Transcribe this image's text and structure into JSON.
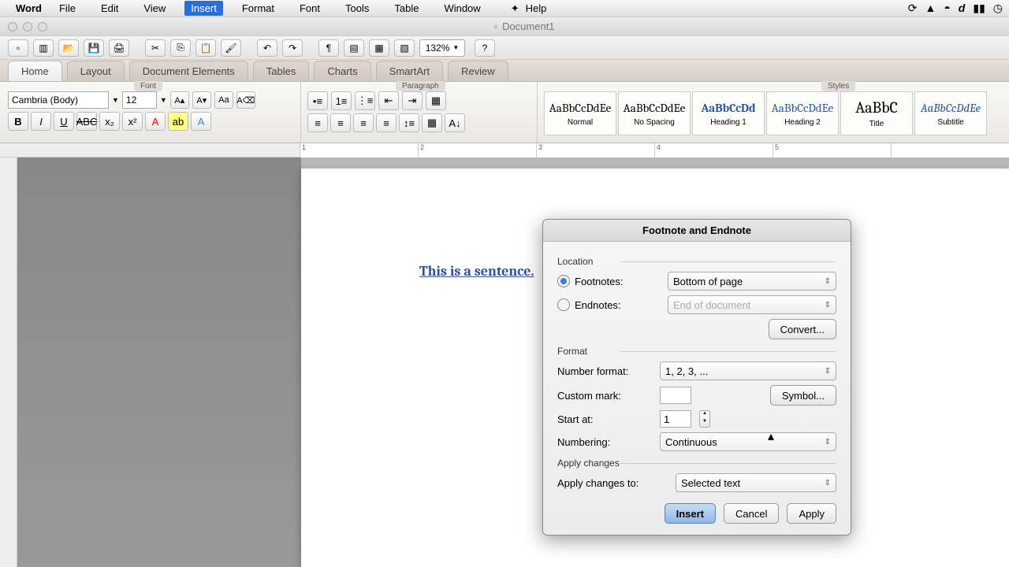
{
  "menubar": {
    "app": "Word",
    "items": [
      "File",
      "Edit",
      "View",
      "Insert",
      "Format",
      "Font",
      "Tools",
      "Table",
      "Window"
    ],
    "help": "Help",
    "active_index": 3
  },
  "titlebar": {
    "doc_name": "Document1"
  },
  "toolbar": {
    "zoom": "132%"
  },
  "ribbon": {
    "tabs": [
      "Home",
      "Layout",
      "Document Elements",
      "Tables",
      "Charts",
      "SmartArt",
      "Review"
    ],
    "active_tab": 0,
    "groups": {
      "font": "Font",
      "paragraph": "Paragraph",
      "styles": "Styles"
    },
    "font_name": "Cambria (Body)",
    "font_size": "12",
    "styles": [
      {
        "preview": "AaBbCcDdEe",
        "label": "Normal"
      },
      {
        "preview": "AaBbCcDdEe",
        "label": "No Spacing"
      },
      {
        "preview": "AaBbCcDd",
        "label": "Heading 1"
      },
      {
        "preview": "AaBbCcDdEe",
        "label": "Heading 2"
      },
      {
        "preview": "AaBbC",
        "label": "Title"
      },
      {
        "preview": "AaBbCcDdEe",
        "label": "Subtitle"
      }
    ]
  },
  "document": {
    "text": "This is a sentence."
  },
  "dialog": {
    "title": "Footnote and Endnote",
    "sections": {
      "location": "Location",
      "format": "Format",
      "apply": "Apply changes"
    },
    "location": {
      "footnotes_label": "Footnotes:",
      "endnotes_label": "Endnotes:",
      "footnotes_selected": true,
      "footnotes_loc": "Bottom of page",
      "endnotes_loc": "End of document",
      "convert": "Convert..."
    },
    "format": {
      "number_format_label": "Number format:",
      "number_format": "1, 2, 3, ...",
      "custom_mark_label": "Custom mark:",
      "custom_mark": "",
      "symbol": "Symbol...",
      "start_at_label": "Start at:",
      "start_at": "1",
      "numbering_label": "Numbering:",
      "numbering": "Continuous"
    },
    "apply_changes": {
      "label": "Apply changes to:",
      "value": "Selected text"
    },
    "buttons": {
      "insert": "Insert",
      "cancel": "Cancel",
      "apply": "Apply"
    }
  }
}
